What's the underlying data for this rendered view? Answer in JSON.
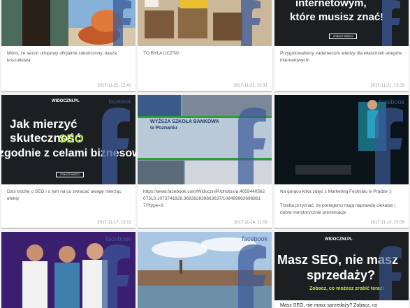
{
  "cards": [
    {
      "text": "Mimo, że sezon urlopowy oficjalnie zakończony, nasza koszulkowa",
      "date": "2017-11-22, 12:41",
      "thumb_title": ""
    },
    {
      "text": "TO BYŁA UCZTA!",
      "date": "2017-11-21, 15:31",
      "thumb_title": ""
    },
    {
      "text": "Przygotowaliśmy vademecum wiedzy dla właścicieli sklepów internetowych!",
      "date": "2017-11-21, 13:33",
      "thumb_title_1": "internetowym,",
      "thumb_title_2": "które musisz znać!",
      "thumb_button": "ZOBACZ WIĘCEJ"
    },
    {
      "text": "Dziś trochę o SEO i o tym na co zwracać uwagę mierząc efekty",
      "date": "2017-11-17, 13:12",
      "brand": "WIDOCZNI.PL",
      "fb_word": "facebook",
      "thumb_title_1": "Jak mierzyć skuteczność",
      "thumb_title_2": "SEO",
      "thumb_title_3": "zgodnie z celami biznesowymi",
      "thumb_button": "ZOBACZ WIĘCEJ"
    },
    {
      "text": "https://www.facebook.com/WidoczniPl/photos/a.405944056207313.1073741828.369382839863637/1064999636968617/?type=3",
      "date": "2017-11-14, 11:09",
      "thumb_title": "WYŻSZA SZKOŁA BANKOWA\nw Poznaniu"
    },
    {
      "text": "Na gorąco klika zdjęć z Marketing Festivalu w Pradze :)\n\nTrzeba przyznać, że prelegenci mają naprawdę ciekawe i dobre merytorycznie prezentacje",
      "date": "2017-11-10, 15:09",
      "fb_word": "facebook"
    },
    {
      "text": "",
      "date": "",
      "fb_word": "facebook"
    },
    {
      "text": "",
      "date": "",
      "fb_word": "facebook"
    },
    {
      "text": "Masz SEO, nie masz sprzedaży? Zobacz, co",
      "date": "",
      "brand": "WIDOCZNI.PL",
      "thumb_title_1": "Masz SEO, nie masz",
      "thumb_title_2": "sprzedaży?",
      "thumb_title_3": "Zobacz, co możesz zrobić teraz!"
    }
  ],
  "colors": {
    "accent": "#3b5998",
    "seo_green": "#b6e84a",
    "dark_bg": "#1c1f21"
  }
}
